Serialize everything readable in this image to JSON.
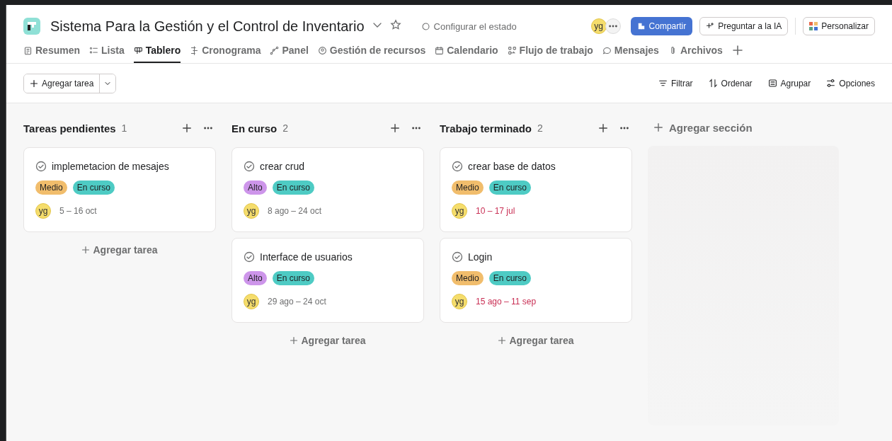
{
  "project": {
    "title": "Sistema Para la Gestión y el Control de Inventario",
    "status": "Configurar el estado",
    "avatar": "yg",
    "share": "Compartir",
    "ask_ai": "Preguntar a la IA",
    "customize": "Personalizar"
  },
  "tabs": [
    {
      "label": "Resumen",
      "selected": false
    },
    {
      "label": "Lista",
      "selected": false
    },
    {
      "label": "Tablero",
      "selected": true
    },
    {
      "label": "Cronograma",
      "selected": false
    },
    {
      "label": "Panel",
      "selected": false
    },
    {
      "label": "Gestión de recursos",
      "selected": false
    },
    {
      "label": "Calendario",
      "selected": false
    },
    {
      "label": "Flujo de trabajo",
      "selected": false
    },
    {
      "label": "Mensajes",
      "selected": false
    },
    {
      "label": "Archivos",
      "selected": false
    }
  ],
  "toolbar": {
    "add_task": "Agregar tarea",
    "actions": [
      "Filtrar",
      "Ordenar",
      "Agrupar",
      "Opciones"
    ]
  },
  "columns": [
    {
      "title": "Tareas pendientes",
      "count": "1",
      "add_task": "Agregar tarea",
      "tasks": [
        {
          "name": "implemetacion de mesajes",
          "tags": [
            {
              "label": "Medio",
              "color": "#f1bd6c"
            },
            {
              "label": "En curso",
              "color": "#4ecbc4"
            }
          ],
          "assignee": "yg",
          "dates": "5 – 16 oct",
          "overdue": false
        }
      ]
    },
    {
      "title": "En curso",
      "count": "2",
      "add_task": "Agregar tarea",
      "tasks": [
        {
          "name": "crear crud",
          "tags": [
            {
              "label": "Alto",
              "color": "#cd95ea"
            },
            {
              "label": "En curso",
              "color": "#4ecbc4"
            }
          ],
          "assignee": "yg",
          "dates": "8 ago – 24 oct",
          "overdue": false
        },
        {
          "name": "Interface de usuarios",
          "tags": [
            {
              "label": "Alto",
              "color": "#cd95ea"
            },
            {
              "label": "En curso",
              "color": "#4ecbc4"
            }
          ],
          "assignee": "yg",
          "dates": "29 ago – 24 oct",
          "overdue": false
        }
      ]
    },
    {
      "title": "Trabajo terminado",
      "count": "2",
      "add_task": "Agregar tarea",
      "tasks": [
        {
          "name": "crear base de datos",
          "tags": [
            {
              "label": "Medio",
              "color": "#f1bd6c"
            },
            {
              "label": "En curso",
              "color": "#4ecbc4"
            }
          ],
          "assignee": "yg",
          "dates": "10 – 17 jul",
          "overdue": true
        },
        {
          "name": "Login",
          "tags": [
            {
              "label": "Medio",
              "color": "#f1bd6c"
            },
            {
              "label": "En curso",
              "color": "#4ecbc4"
            }
          ],
          "assignee": "yg",
          "dates": "15 ago – 11 sep",
          "overdue": true
        }
      ]
    }
  ],
  "add_section": "Agregar sección"
}
